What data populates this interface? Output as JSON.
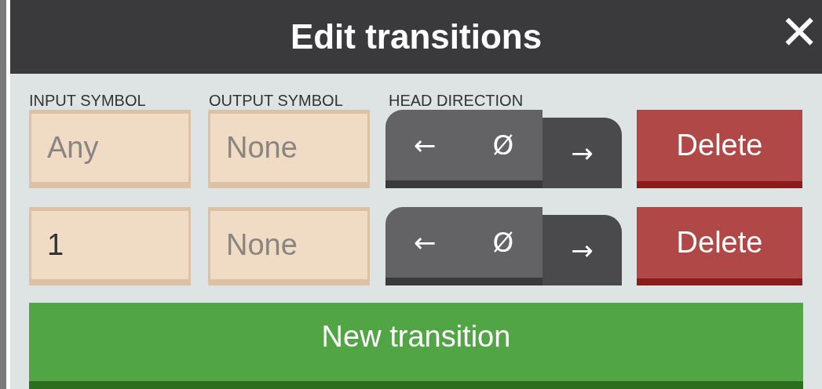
{
  "dialog": {
    "title": "Edit transitions",
    "close": "✕"
  },
  "columns": [
    "INPUT SYMBOL",
    "OUTPUT SYMBOL",
    "HEAD DIRECTION"
  ],
  "transitions": [
    {
      "input": {
        "placeholder": "Any"
      },
      "output": {
        "placeholder": "None"
      },
      "directions": [
        {
          "symbol": "←",
          "selected": false
        },
        {
          "symbol": "Ø",
          "selected": false
        },
        {
          "symbol": "→",
          "selected": true
        }
      ],
      "delete": "Delete"
    },
    {
      "input": {
        "value": "1"
      },
      "output": {
        "placeholder": "None"
      },
      "directions": [
        {
          "symbol": "←",
          "selected": false
        },
        {
          "symbol": "Ø",
          "selected": false
        },
        {
          "symbol": "→",
          "selected": true
        }
      ],
      "delete": "Delete"
    }
  ],
  "new_button": "New transition"
}
